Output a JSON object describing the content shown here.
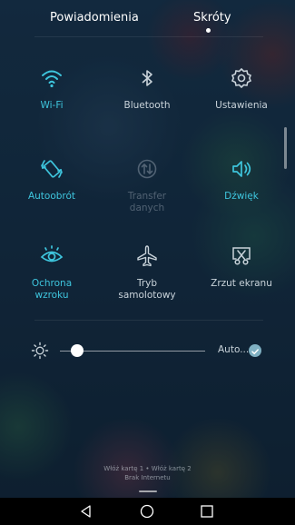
{
  "tabs": {
    "notifications": "Powiadomienia",
    "shortcuts": "Skróty"
  },
  "tiles": {
    "wifi": "Wi-Fi",
    "bluetooth": "Bluetooth",
    "settings": "Ustawienia",
    "autorotate": "Autoobrót",
    "transfer_line1": "Transfer",
    "transfer_line2": "danych",
    "sound": "Dźwięk",
    "eye_line1": "Ochrona",
    "eye_line2": "wzroku",
    "airplane_line1": "Tryb",
    "airplane_line2": "samolotowy",
    "screenshot": "Zrzut ekranu"
  },
  "brightness": {
    "auto_label": "Auto...",
    "level": 0.12
  },
  "status": {
    "carrier": "Włóż kartę 1 • Włóż kartę 2",
    "internet": "Brak Internetu"
  },
  "colors": {
    "accent": "#3ec5dd",
    "inactive": "#c9d3da"
  }
}
